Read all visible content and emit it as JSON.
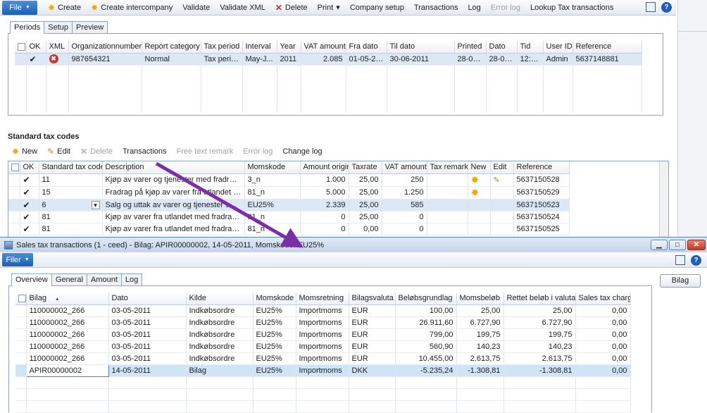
{
  "top": {
    "menu": {
      "file": "File",
      "items": [
        {
          "label": "Create",
          "icon": "sun-icon",
          "disabled": false
        },
        {
          "label": "Create intercompany",
          "icon": "sun-icon",
          "disabled": false
        },
        {
          "label": "Validate",
          "disabled": false
        },
        {
          "label": "Validate XML",
          "disabled": false
        },
        {
          "label": "Delete",
          "icon": "delete-x-icon",
          "disabled": false
        },
        {
          "label": "Print",
          "dropdown": true,
          "disabled": false
        },
        {
          "label": "Company setup",
          "disabled": false
        },
        {
          "label": "Transactions",
          "disabled": false
        },
        {
          "label": "Log",
          "disabled": false
        },
        {
          "label": "Error log",
          "disabled": true
        },
        {
          "label": "Lookup Tax transactions",
          "disabled": false
        }
      ]
    },
    "tabs": [
      "Periods",
      "Setup",
      "Preview"
    ],
    "periods_table": {
      "columns": [
        "OK",
        "XML",
        "Organizationnumber",
        "Report category",
        "Tax period",
        "Interval",
        "Year",
        "VAT amount",
        "Fra dato",
        "Til dato",
        "Printed",
        "Dato",
        "Tid",
        "User ID",
        "Reference"
      ],
      "rows": [
        {
          "ok": "✔",
          "xml": "✖",
          "org": "987654321",
          "category": "Normal",
          "tax_period": "Tax perio...",
          "interval": "May-J...",
          "year": "2011",
          "vat": "2.085",
          "fra": "01-05-20...",
          "til": "30-06-2011",
          "printed": "28-07...",
          "dato": "28-07-2...",
          "tid": "12:5...",
          "user": "Admin",
          "ref": "5637148881"
        }
      ]
    },
    "std_title": "Standard tax codes",
    "std_toolbar": [
      {
        "label": "New",
        "icon": "sun-icon",
        "disabled": false
      },
      {
        "label": "Edit",
        "icon": "pencil-icon",
        "disabled": false
      },
      {
        "label": "Delete",
        "icon": "delete-x-icon",
        "disabled": true
      },
      {
        "label": "Transactions",
        "disabled": false
      },
      {
        "label": "Free text remark",
        "disabled": true
      },
      {
        "label": "Error log",
        "disabled": true
      },
      {
        "label": "Change log",
        "disabled": false
      }
    ],
    "std_table": {
      "columns": [
        "OK",
        "Standard tax code",
        "Description",
        "Momskode",
        "Amount origin",
        "Taxrate",
        "VAT amount",
        "Tax remark",
        "New",
        "Edit",
        "Reference"
      ],
      "rows": [
        {
          "ok": "✔",
          "code": "11",
          "desc": "Kjøp av varer og tjenester med fradragsrett ...",
          "moms": "3_n",
          "amount": "1.000",
          "rate": "25,00",
          "vat": "250",
          "remark": "",
          "new": true,
          "edit": true,
          "ref": "5637150528"
        },
        {
          "ok": "✔",
          "code": "15",
          "desc": "Fradrag på kjøp av varer fra utlandet (merv...",
          "moms": "81_n",
          "amount": "5.000",
          "rate": "25,00",
          "vat": "1.250",
          "remark": "",
          "new": true,
          "edit": false,
          "ref": "5637150529"
        },
        {
          "ok": "✔",
          "code": "6",
          "desc": "Salg og uttak av varer og tjenester som er ...",
          "moms": "EU25%",
          "amount": "2.339",
          "rate": "25,00",
          "vat": "585",
          "remark": "",
          "new": false,
          "edit": false,
          "ref": "5637150523"
        },
        {
          "ok": "✔",
          "code": "81",
          "desc": "Kjøp av varer fra utlandet med fradragsrett ...",
          "moms": "81_n",
          "amount": "0",
          "rate": "25,00",
          "vat": "0",
          "remark": "",
          "new": false,
          "edit": false,
          "ref": "5637150524"
        },
        {
          "ok": "✔",
          "code": "81",
          "desc": "Kjøp av varer fra utlandet med fradragsrett ...",
          "moms": "81_n",
          "amount": "0",
          "rate": "0,00",
          "vat": "0",
          "remark": "",
          "new": false,
          "edit": false,
          "ref": "5637150525"
        }
      ]
    }
  },
  "bottom": {
    "title": "Sales tax transactions (1 - ceed) - Bilag: APIR00000002, 14-05-2011, Momskode: EU25%",
    "menu": {
      "file": "Filer"
    },
    "tabs": [
      "Overview",
      "General",
      "Amount",
      "Log"
    ],
    "bilag_button": "Bilag",
    "table": {
      "columns": [
        "Bilag",
        "Dato",
        "Kilde",
        "Momskode",
        "Momsretning",
        "Bilagsvaluta",
        "Beløbsgrundlag",
        "Momsbeløb",
        "Rettet beløb i valuta",
        "Sales tax charge"
      ],
      "rows": [
        {
          "bilag": "110000002_266",
          "dato": "03-05-2011",
          "kilde": "Indkøbsordre",
          "moms": "EU25%",
          "retning": "Importmoms",
          "valuta": "EUR",
          "grundlag": "100,00",
          "belob": "25,00",
          "rettet": "25,00",
          "charge": "0,00"
        },
        {
          "bilag": "110000002_266",
          "dato": "03-05-2011",
          "kilde": "Indkøbsordre",
          "moms": "EU25%",
          "retning": "Importmoms",
          "valuta": "EUR",
          "grundlag": "26.911,60",
          "belob": "6.727,90",
          "rettet": "6.727,90",
          "charge": "0,00"
        },
        {
          "bilag": "110000002_266",
          "dato": "03-05-2011",
          "kilde": "Indkøbsordre",
          "moms": "EU25%",
          "retning": "Importmoms",
          "valuta": "EUR",
          "grundlag": "799,00",
          "belob": "199,75",
          "rettet": "199,75",
          "charge": "0,00"
        },
        {
          "bilag": "110000002_266",
          "dato": "03-05-2011",
          "kilde": "Indkøbsordre",
          "moms": "EU25%",
          "retning": "Importmoms",
          "valuta": "EUR",
          "grundlag": "560,90",
          "belob": "140,23",
          "rettet": "140,23",
          "charge": "0,00"
        },
        {
          "bilag": "110000002_266",
          "dato": "03-05-2011",
          "kilde": "Indkøbsordre",
          "moms": "EU25%",
          "retning": "Importmoms",
          "valuta": "EUR",
          "grundlag": "10.455,00",
          "belob": "2.613,75",
          "rettet": "2.613,75",
          "charge": "0,00"
        },
        {
          "bilag": "APIR00000002",
          "dato": "14-05-2011",
          "kilde": "Bilag",
          "moms": "EU25%",
          "retning": "Importmoms",
          "valuta": "DKK",
          "grundlag": "-5.235,24",
          "belob": "-1.308,81",
          "rettet": "-1.308,81",
          "charge": "0,00"
        }
      ]
    }
  },
  "colors": {
    "accent": "#1c5fb3",
    "arrow": "#7a2fa8",
    "selected_row": "#cfe4f7"
  }
}
